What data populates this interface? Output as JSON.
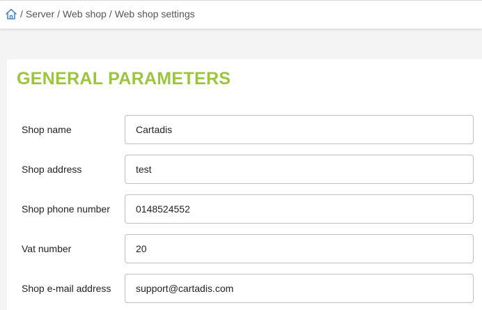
{
  "breadcrumb": {
    "home_icon": "home-icon",
    "separator": "/",
    "items": [
      "Server",
      "Web shop",
      "Web shop settings"
    ]
  },
  "section": {
    "title": "GENERAL PARAMETERS",
    "title_color": "#9cc53b"
  },
  "fields": [
    {
      "label": "Shop name",
      "value": "Cartadis"
    },
    {
      "label": "Shop address",
      "value": "test"
    },
    {
      "label": "Shop phone number",
      "value": "0148524552"
    },
    {
      "label": "Vat number",
      "value": "20"
    },
    {
      "label": "Shop e-mail address",
      "value": "support@cartadis.com"
    }
  ]
}
